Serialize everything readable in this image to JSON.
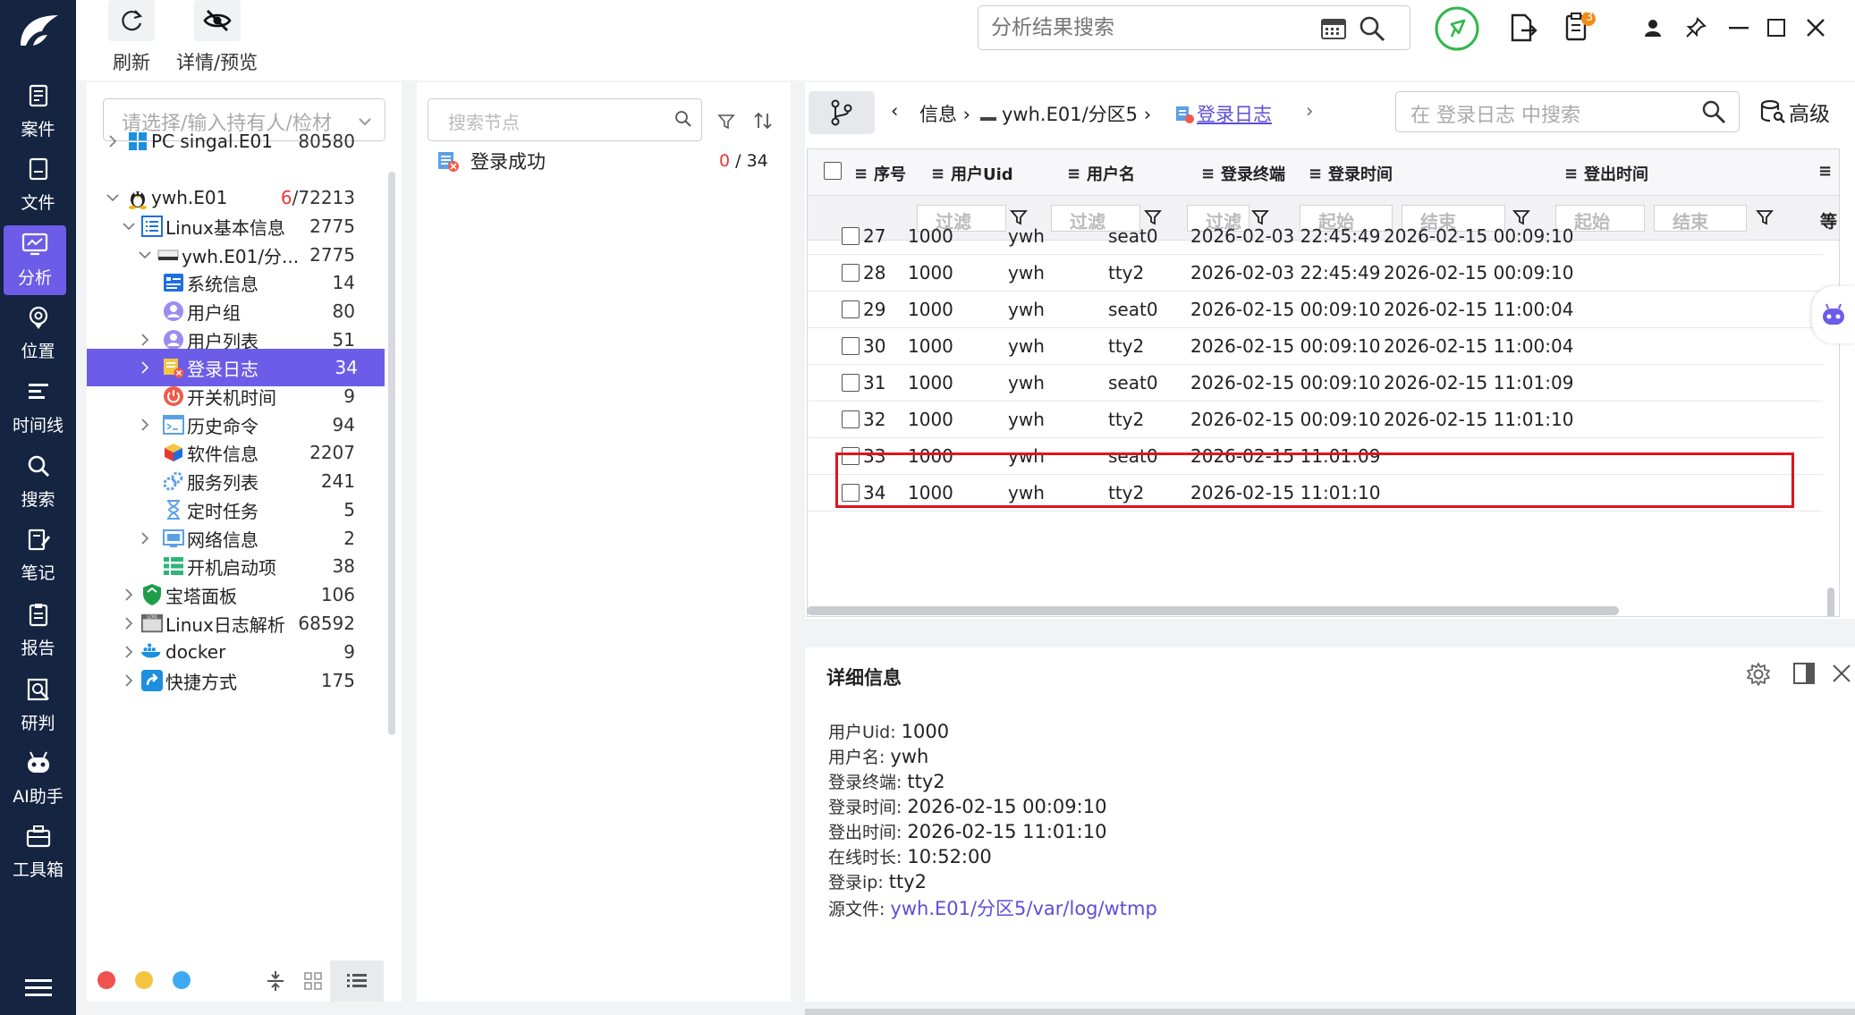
{
  "rail": {
    "items": [
      {
        "label": "案件",
        "icon": "case-icon"
      },
      {
        "label": "文件",
        "icon": "file-icon"
      },
      {
        "label": "分析",
        "icon": "analysis-icon",
        "active": true
      },
      {
        "label": "位置",
        "icon": "location-icon"
      },
      {
        "label": "时间线",
        "icon": "timeline-icon"
      },
      {
        "label": "搜索",
        "icon": "search-icon"
      },
      {
        "label": "笔记",
        "icon": "note-icon"
      },
      {
        "label": "报告",
        "icon": "report-icon"
      },
      {
        "label": "研判",
        "icon": "judge-icon"
      },
      {
        "label": "AI助手",
        "icon": "robot-icon"
      },
      {
        "label": "工具箱",
        "icon": "toolbox-icon"
      }
    ],
    "active_color": "#6c5ce7",
    "bg_color": "#142441"
  },
  "toolbar": {
    "refresh_label": "刷新",
    "preview_label": "详情/预览",
    "search_placeholder": "分析结果搜索",
    "badge_count": "3"
  },
  "tree": {
    "owner_placeholder": "请选择/输入持有人/检材",
    "rows": [
      {
        "label": "PC singal.E01",
        "count": "80580",
        "icon": "windows-icon"
      },
      {
        "label": "ywh.E01",
        "count_red": "6",
        "count_rest": "/72213",
        "icon": "linux-icon"
      },
      {
        "label": "Linux基本信息",
        "count": "2775",
        "icon": "list-icon"
      },
      {
        "label": "ywh.E01/分...",
        "count": "2775",
        "icon": "disk-icon"
      },
      {
        "label": "系统信息",
        "count": "14",
        "icon": "sysinfo-icon"
      },
      {
        "label": "用户组",
        "count": "80",
        "icon": "usergroup-icon"
      },
      {
        "label": "用户列表",
        "count": "51",
        "icon": "userlist-icon"
      },
      {
        "label": "登录日志",
        "count": "34",
        "icon": "loginlog-icon"
      },
      {
        "label": "开关机时间",
        "count": "9",
        "icon": "power-icon"
      },
      {
        "label": "历史命令",
        "count": "94",
        "icon": "terminal-icon"
      },
      {
        "label": "软件信息",
        "count": "2207",
        "icon": "software-icon"
      },
      {
        "label": "服务列表",
        "count": "241",
        "icon": "service-icon"
      },
      {
        "label": "定时任务",
        "count": "5",
        "icon": "timer-icon"
      },
      {
        "label": "网络信息",
        "count": "2",
        "icon": "network-icon"
      },
      {
        "label": "开机启动项",
        "count": "38",
        "icon": "startup-icon"
      },
      {
        "label": "宝塔面板",
        "count": "106",
        "icon": "shield-icon"
      },
      {
        "label": "Linux日志解析",
        "count": "68592",
        "icon": "log-icon"
      },
      {
        "label": "docker",
        "count": "9",
        "icon": "docker-icon"
      },
      {
        "label": "快捷方式",
        "count": "175",
        "icon": "shortcut-icon"
      }
    ],
    "dot_colors": [
      "#f0524f",
      "#f5c542",
      "#3da9f5"
    ]
  },
  "nodes": {
    "search_placeholder": "搜索节点",
    "items": [
      {
        "label": "登录成功",
        "count_red": "0",
        "count_rest": " / 34"
      }
    ]
  },
  "breadcrumb": {
    "part1": "信息",
    "part2": "ywh.E01/分区5",
    "part3": "登录日志",
    "table_search_placeholder": "在 登录日志 中搜索",
    "advanced_label": "高级"
  },
  "table": {
    "columns": [
      "序号",
      "用户Uid",
      "用户名",
      "登录终端",
      "登录时间",
      "登出时间"
    ],
    "filter_placeholder": "过滤",
    "start_placeholder": "起始",
    "end_placeholder": "结束",
    "overflow_label": "等",
    "rows": [
      {
        "no": "27",
        "uid": "1000",
        "user": "ywh",
        "term": "seat0",
        "login": "2026-02-03 22:45:49",
        "logout": "2026-02-15 00:09:10"
      },
      {
        "no": "28",
        "uid": "1000",
        "user": "ywh",
        "term": "tty2",
        "login": "2026-02-03 22:45:49",
        "logout": "2026-02-15 00:09:10"
      },
      {
        "no": "29",
        "uid": "1000",
        "user": "ywh",
        "term": "seat0",
        "login": "2026-02-15 00:09:10",
        "logout": "2026-02-15 11:00:04"
      },
      {
        "no": "30",
        "uid": "1000",
        "user": "ywh",
        "term": "tty2",
        "login": "2026-02-15 00:09:10",
        "logout": "2026-02-15 11:00:04"
      },
      {
        "no": "31",
        "uid": "1000",
        "user": "ywh",
        "term": "seat0",
        "login": "2026-02-15 00:09:10",
        "logout": "2026-02-15 11:01:09"
      },
      {
        "no": "32",
        "uid": "1000",
        "user": "ywh",
        "term": "tty2",
        "login": "2026-02-15 00:09:10",
        "logout": "2026-02-15 11:01:10"
      },
      {
        "no": "33",
        "uid": "1000",
        "user": "ywh",
        "term": "seat0",
        "login": "2026-02-15 11:01:09",
        "logout": ""
      },
      {
        "no": "34",
        "uid": "1000",
        "user": "ywh",
        "term": "tty2",
        "login": "2026-02-15 11:01:10",
        "logout": ""
      }
    ]
  },
  "detail": {
    "title": "详细信息",
    "fields": [
      {
        "key": "用户Uid:",
        "value": "1000"
      },
      {
        "key": "用户名:",
        "value": "ywh"
      },
      {
        "key": "登录终端:",
        "value": "tty2"
      },
      {
        "key": "登录时间:",
        "value": "2026-02-15 00:09:10"
      },
      {
        "key": "登出时间:",
        "value": "2026-02-15 11:01:10"
      },
      {
        "key": "在线时长:",
        "value": "10:52:00"
      },
      {
        "key": "登录ip:",
        "value": "tty2"
      },
      {
        "key": "源文件:",
        "value": "ywh.E01/分区5/var/log/wtmp"
      }
    ]
  }
}
